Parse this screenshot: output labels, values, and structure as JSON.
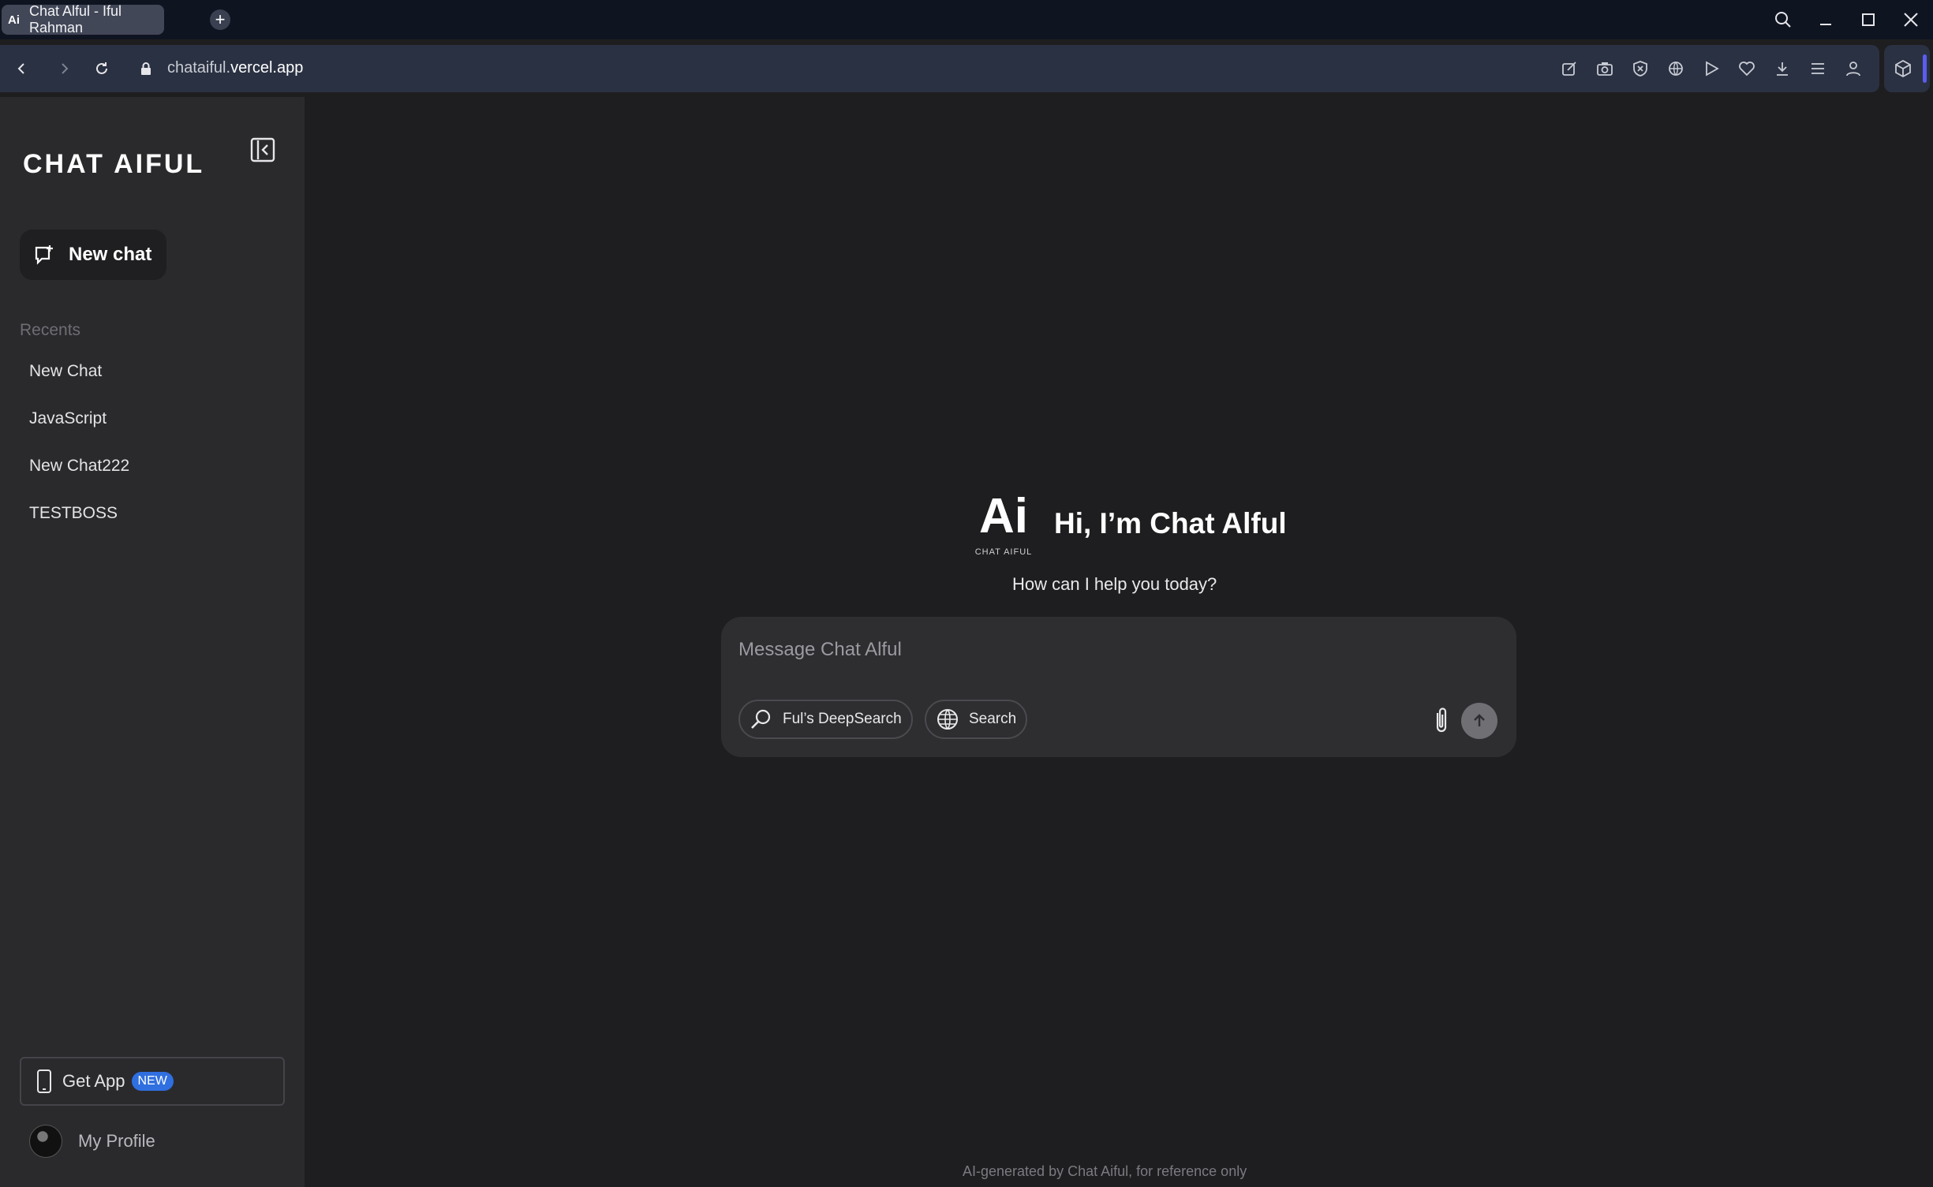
{
  "browser": {
    "tab_title": "Chat Alful - Iful Rahman",
    "tab_favicon": "Ai",
    "url_prefix": "chataiful.",
    "url_domain": "vercel.app"
  },
  "sidebar": {
    "brand": "CHAT AIFUL",
    "new_chat_label": "New chat",
    "recents_label": "Recents",
    "recents": [
      {
        "label": "New Chat"
      },
      {
        "label": "JavaScript"
      },
      {
        "label": "New Chat222"
      },
      {
        "label": "TESTBOSS"
      }
    ],
    "get_app_label": "Get App",
    "get_app_badge": "NEW",
    "profile_label": "My Profile"
  },
  "main": {
    "logo_text": "Ai",
    "logo_caption": "CHAT AIFUL",
    "greeting": "Hi, I’m Chat Alful",
    "subtitle": "How can I help you today?",
    "composer": {
      "placeholder": "Message Chat Alful",
      "deepsearch_label": "Ful’s DeepSearch",
      "search_label": "Search"
    },
    "footer_note": "AI-generated by Chat Aiful, for reference only"
  },
  "colors": {
    "sidebar_bg": "#2a2a2d",
    "main_bg": "#1e1e20",
    "badge": "#2f6fe0",
    "accent_bar": "#5b5cf0"
  }
}
